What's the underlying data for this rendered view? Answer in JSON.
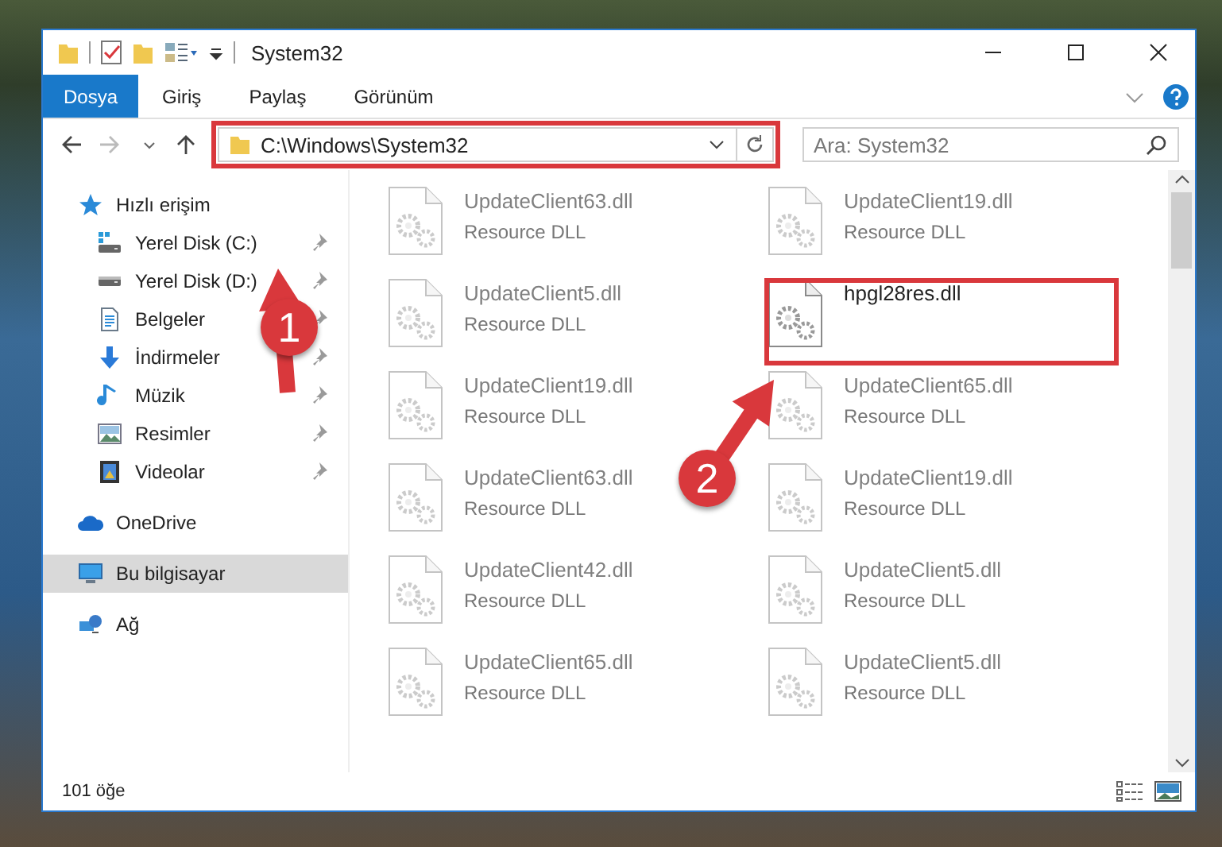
{
  "window": {
    "title": "System32"
  },
  "ribbon": {
    "tabs": [
      {
        "label": "Dosya",
        "selected": true
      },
      {
        "label": "Giriş",
        "selected": false
      },
      {
        "label": "Paylaş",
        "selected": false
      },
      {
        "label": "Görünüm",
        "selected": false
      }
    ]
  },
  "address_bar": {
    "path": "C:\\Windows\\System32",
    "highlighted": true
  },
  "search": {
    "placeholder": "Ara: System32"
  },
  "sidebar": {
    "items": [
      {
        "label": "Hızlı erişim",
        "kind": "star",
        "selected": false,
        "children": [
          {
            "label": "Yerel Disk (C:)",
            "kind": "windrive",
            "pinned": true,
            "selected": false
          },
          {
            "label": "Yerel Disk (D:)",
            "kind": "drive",
            "pinned": true,
            "selected": false
          },
          {
            "label": "Belgeler",
            "kind": "docs",
            "pinned": true,
            "selected": false
          },
          {
            "label": "İndirmeler",
            "kind": "download",
            "pinned": true,
            "selected": false
          },
          {
            "label": "Müzik",
            "kind": "music",
            "pinned": true,
            "selected": false
          },
          {
            "label": "Resimler",
            "kind": "pictures",
            "pinned": true,
            "selected": false
          },
          {
            "label": "Videolar",
            "kind": "video",
            "pinned": true,
            "selected": false
          }
        ]
      },
      {
        "label": "OneDrive",
        "kind": "cloud",
        "selected": false
      },
      {
        "label": "Bu bilgisayar",
        "kind": "computer",
        "selected": true
      },
      {
        "label": "Ağ",
        "kind": "network",
        "selected": false
      }
    ]
  },
  "files": [
    {
      "name": "UpdateClient63.dll",
      "type": "Resource DLL",
      "blurred": true,
      "highlighted": false
    },
    {
      "name": "UpdateClient19.dll",
      "type": "Resource DLL",
      "blurred": true,
      "highlighted": false
    },
    {
      "name": "UpdateClient5.dll",
      "type": "Resource DLL",
      "blurred": true,
      "highlighted": false
    },
    {
      "name": "hpgl28res.dll",
      "blurred": false,
      "highlighted": true
    },
    {
      "name": "UpdateClient19.dll",
      "type": "Resource DLL",
      "blurred": true,
      "highlighted": false
    },
    {
      "name": "UpdateClient65.dll",
      "type": "Resource DLL",
      "blurred": true,
      "highlighted": false
    },
    {
      "name": "UpdateClient63.dll",
      "type": "Resource DLL",
      "blurred": true,
      "highlighted": false
    },
    {
      "name": "UpdateClient19.dll",
      "type": "Resource DLL",
      "blurred": true,
      "highlighted": false
    },
    {
      "name": "UpdateClient42.dll",
      "type": "Resource DLL",
      "blurred": true,
      "highlighted": false
    },
    {
      "name": "UpdateClient5.dll",
      "type": "Resource DLL",
      "blurred": true,
      "highlighted": false
    },
    {
      "name": "UpdateClient65.dll",
      "type": "Resource DLL",
      "blurred": true,
      "highlighted": false
    },
    {
      "name": "UpdateClient5.dll",
      "type": "Resource DLL",
      "blurred": true,
      "highlighted": false
    }
  ],
  "annotations": [
    {
      "number": "1"
    },
    {
      "number": "2"
    }
  ],
  "status_bar": {
    "item_count": "101 öğe"
  }
}
